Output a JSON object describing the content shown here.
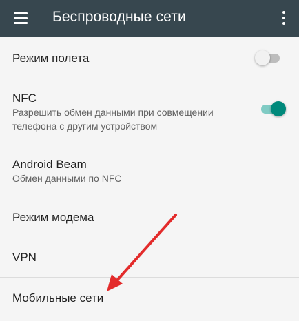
{
  "appbar": {
    "title": "Беспроводные сети",
    "menu_icon": "hamburger-menu-icon",
    "more_icon": "more-vert-icon",
    "background": "#37474f"
  },
  "settings": {
    "airplane": {
      "title": "Режим полета",
      "enabled": false
    },
    "nfc": {
      "title": "NFC",
      "summary": "Разрешить обмен данными при совмещении телефона с другим устройством",
      "enabled": true
    },
    "android_beam": {
      "title": "Android Beam",
      "summary": "Обмен данными по NFC"
    },
    "tethering": {
      "title": "Режим модема"
    },
    "vpn": {
      "title": "VPN"
    },
    "mobile_networks": {
      "title": "Мобильные сети"
    }
  },
  "colors": {
    "accent": "#00897b",
    "accent_track": "#80cbc4",
    "annotation_arrow": "#e32b2b"
  }
}
